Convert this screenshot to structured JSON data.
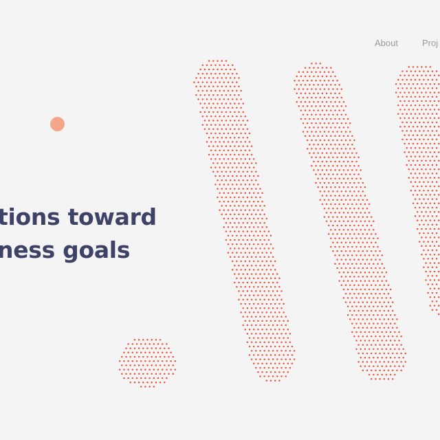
{
  "nav": {
    "items": [
      {
        "label": "About"
      },
      {
        "label": "Proj"
      }
    ]
  },
  "hero": {
    "headline_lines": [
      "tions toward",
      "ness goals"
    ]
  },
  "colors": {
    "background": "#f4f4f4",
    "headline": "#3d4266",
    "dot_pattern": "#e8553e",
    "accent_circle": "#f4a58a",
    "nav_text": "#9a9a9a"
  },
  "decor": {
    "icons": [
      "dotted-stroke-1",
      "dotted-stroke-2",
      "dotted-stroke-3",
      "dotted-blob",
      "accent-dot"
    ]
  }
}
